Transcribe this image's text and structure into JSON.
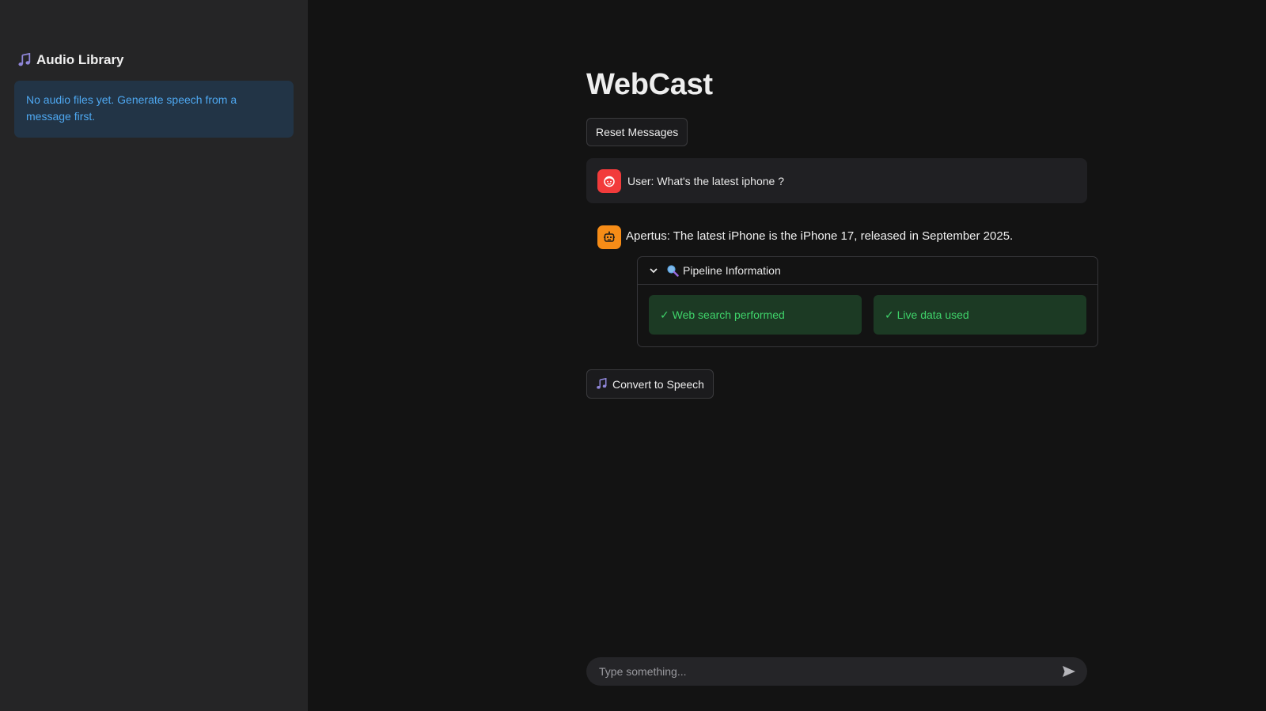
{
  "sidebar": {
    "header": "Audio Library",
    "icon": "music-note-icon",
    "empty_notice": "No audio files yet. Generate speech from a message first."
  },
  "main": {
    "title": "WebCast",
    "reset_button_label": "Reset Messages",
    "messages": [
      {
        "role": "user",
        "avatar_icon": "user-face-icon",
        "avatar_color": "#f23b3b",
        "text": "User: What's the latest iphone ?"
      },
      {
        "role": "assistant",
        "avatar_icon": "robot-icon",
        "avatar_color": "#f68c17",
        "text": "Apertus: The latest iPhone is the iPhone 17, released in September 2025."
      }
    ],
    "pipeline": {
      "label": "Pipeline Information",
      "expanded": true,
      "badges": [
        "✓ Web search performed",
        "✓ Live data used"
      ]
    },
    "convert_button_label": "Convert to Speech",
    "chat_input_placeholder": "Type something..."
  },
  "colors": {
    "background": "#131313",
    "sidebar": "#252526",
    "info_box_bg": "#223446",
    "info_text": "#4ea8f1",
    "success_bg": "#1c3a24",
    "success_text": "#3fd36a"
  }
}
